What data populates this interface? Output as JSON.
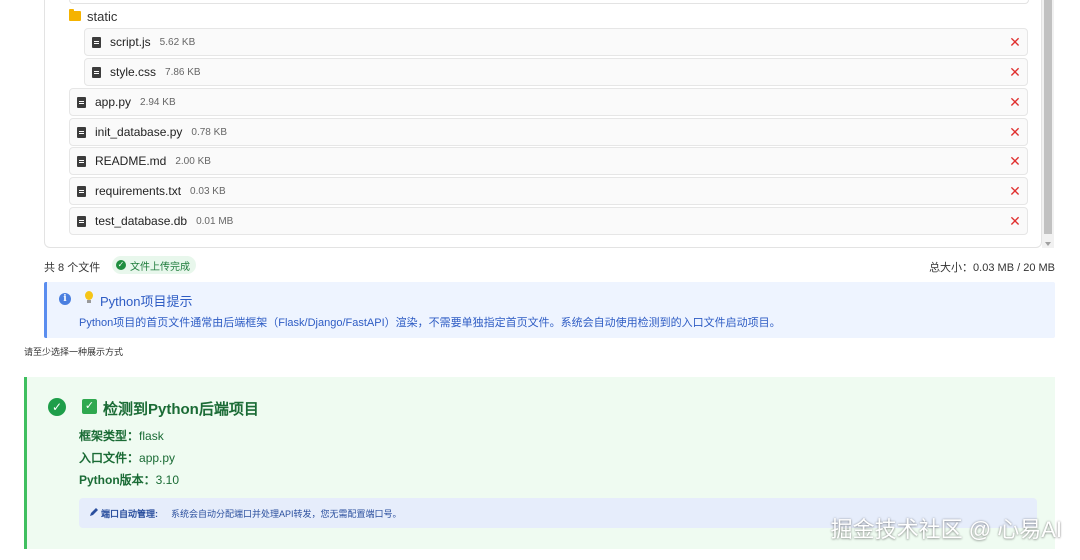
{
  "file_tree": {
    "folder": {
      "name": "static",
      "icon": "folder-icon"
    },
    "files": [
      {
        "name": "script.js",
        "size": "5.62 KB",
        "nested": true
      },
      {
        "name": "style.css",
        "size": "7.86 KB",
        "nested": true
      },
      {
        "name": "app.py",
        "size": "2.94 KB",
        "nested": false
      },
      {
        "name": "init_database.py",
        "size": "0.78 KB",
        "nested": false
      },
      {
        "name": "README.md",
        "size": "2.00 KB",
        "nested": false
      },
      {
        "name": "requirements.txt",
        "size": "0.03 KB",
        "nested": false
      },
      {
        "name": "test_database.db",
        "size": "0.01 MB",
        "nested": false
      }
    ],
    "remove_symbol": "✕"
  },
  "summary": {
    "count_text": "共 8 个文件",
    "upload_status": "文件上传完成",
    "total_size": "总大小：0.03 MB / 20 MB"
  },
  "python_hint": {
    "title": "Python项目提示",
    "text": "Python项目的首页文件通常由后端框架（Flask/Django/FastAPI）渲染，不需要单独指定首页文件。系统会自动使用检测到的入口文件启动项目。"
  },
  "warning": "请至少选择一种展示方式",
  "detection": {
    "title": "检测到Python后端项目",
    "framework_label": "框架类型：",
    "framework_value": "flask",
    "entry_label": "入口文件：",
    "entry_value": "app.py",
    "version_label": "Python版本：",
    "version_value": "3.10",
    "port_label": "端口自动管理:",
    "port_text": "系统会自动分配端口并处理API转发，您无需配置端口号。"
  },
  "watermark": "掘金技术社区 @ 心易AI",
  "colors": {
    "danger": "#e0302f",
    "success": "#1e9e4a",
    "info": "#4a7fe0",
    "folder": "#f5b300"
  }
}
